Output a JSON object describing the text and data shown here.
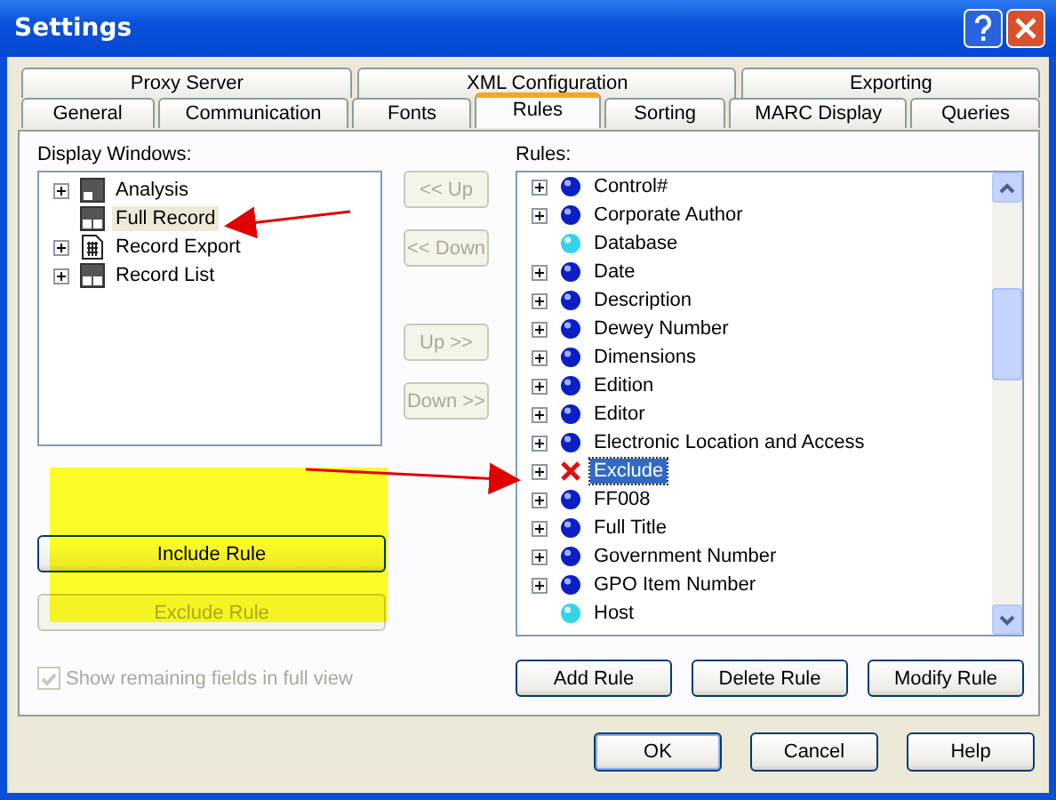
{
  "window": {
    "title": "Settings"
  },
  "tabs_back_row": [
    {
      "label": "Proxy Server",
      "selected": false
    },
    {
      "label": "XML Configuration",
      "selected": false
    },
    {
      "label": "Exporting",
      "selected": false
    }
  ],
  "tabs_front_row": [
    {
      "label": "General",
      "selected": false
    },
    {
      "label": "Communication",
      "selected": false
    },
    {
      "label": "Fonts",
      "selected": false
    },
    {
      "label": "Rules",
      "selected": true
    },
    {
      "label": "Sorting",
      "selected": false
    },
    {
      "label": "MARC Display",
      "selected": false
    },
    {
      "label": "Queries",
      "selected": false
    }
  ],
  "display_windows": {
    "label": "Display Windows:",
    "items": [
      {
        "label": "Analysis",
        "kind": "layout-top",
        "expandable": true,
        "selected": false
      },
      {
        "label": "Full Record",
        "kind": "layout-bottom",
        "expandable": false,
        "selected": true
      },
      {
        "label": "Record Export",
        "kind": "document",
        "expandable": true,
        "selected": false
      },
      {
        "label": "Record List",
        "kind": "layout-bottom",
        "expandable": true,
        "selected": false
      }
    ]
  },
  "move_buttons": [
    {
      "label": "<< Up",
      "disabled": true
    },
    {
      "label": "<< Down",
      "disabled": true
    },
    {
      "label": "Up >>",
      "disabled": true
    },
    {
      "label": "Down >>",
      "disabled": true
    }
  ],
  "rule_buttons": [
    {
      "label": "Include Rule",
      "disabled": false
    },
    {
      "label": "Exclude Rule",
      "disabled": true
    }
  ],
  "show_remaining": {
    "label": "Show remaining fields in full view",
    "checked": true,
    "disabled": true
  },
  "rules": {
    "label": "Rules:",
    "items": [
      {
        "label": "Control#",
        "kind": "blue-dot",
        "expandable": true,
        "selected": false
      },
      {
        "label": "Corporate Author",
        "kind": "blue-dot",
        "expandable": true,
        "selected": false
      },
      {
        "label": "Database",
        "kind": "cyan-dot",
        "expandable": false,
        "selected": false
      },
      {
        "label": "Date",
        "kind": "blue-dot",
        "expandable": true,
        "selected": false
      },
      {
        "label": "Description",
        "kind": "blue-dot",
        "expandable": true,
        "selected": false
      },
      {
        "label": "Dewey Number",
        "kind": "blue-dot",
        "expandable": true,
        "selected": false
      },
      {
        "label": "Dimensions",
        "kind": "blue-dot",
        "expandable": true,
        "selected": false
      },
      {
        "label": "Edition",
        "kind": "blue-dot",
        "expandable": true,
        "selected": false
      },
      {
        "label": "Editor",
        "kind": "blue-dot",
        "expandable": true,
        "selected": false
      },
      {
        "label": "Electronic Location and Access",
        "kind": "blue-dot",
        "expandable": true,
        "selected": false
      },
      {
        "label": "Exclude",
        "kind": "cross",
        "expandable": true,
        "selected": true
      },
      {
        "label": "FF008",
        "kind": "blue-dot",
        "expandable": true,
        "selected": false
      },
      {
        "label": "Full Title",
        "kind": "blue-dot",
        "expandable": true,
        "selected": false
      },
      {
        "label": "Government Number",
        "kind": "blue-dot",
        "expandable": true,
        "selected": false
      },
      {
        "label": "GPO Item Number",
        "kind": "blue-dot",
        "expandable": true,
        "selected": false
      },
      {
        "label": "Host",
        "kind": "cyan-dot",
        "expandable": false,
        "selected": false
      }
    ]
  },
  "rules_buttons": [
    {
      "label": "Add Rule"
    },
    {
      "label": "Delete Rule"
    },
    {
      "label": "Modify Rule"
    }
  ],
  "dialog_buttons": [
    {
      "label": "OK",
      "default": true
    },
    {
      "label": "Cancel",
      "default": false
    },
    {
      "label": "Help",
      "default": false
    }
  ]
}
